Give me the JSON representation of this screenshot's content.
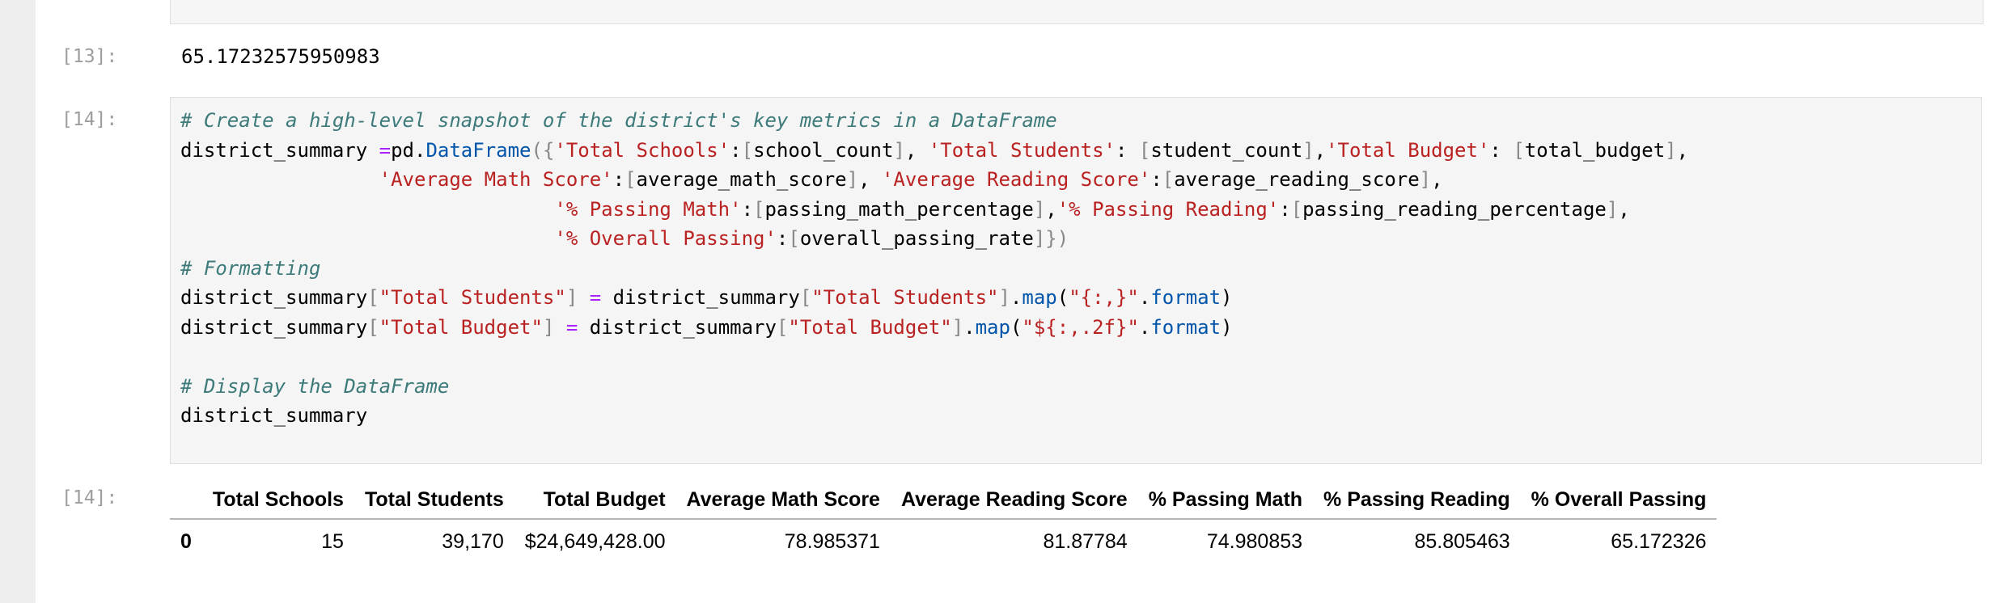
{
  "cells": {
    "prompt_13": "[13]:",
    "output_13": "65.17232575950983",
    "prompt_14": "[14]:",
    "prompt_14_out": "[14]:"
  },
  "code_lines": [
    [
      {
        "t": "com",
        "v": "# Create a high-level snapshot of the district's key metrics in a DataFrame"
      }
    ],
    [
      {
        "t": "txt",
        "v": "district_summary "
      },
      {
        "t": "op",
        "v": "="
      },
      {
        "t": "txt",
        "v": "pd."
      },
      {
        "t": "attr",
        "v": "DataFrame"
      },
      {
        "t": "pun",
        "v": "({"
      },
      {
        "t": "str",
        "v": "'Total Schools'"
      },
      {
        "t": "txt",
        "v": ":"
      },
      {
        "t": "pun",
        "v": "["
      },
      {
        "t": "txt",
        "v": "school_count"
      },
      {
        "t": "pun",
        "v": "]"
      },
      {
        "t": "txt",
        "v": ", "
      },
      {
        "t": "str",
        "v": "'Total Students'"
      },
      {
        "t": "txt",
        "v": ": "
      },
      {
        "t": "pun",
        "v": "["
      },
      {
        "t": "txt",
        "v": "student_count"
      },
      {
        "t": "pun",
        "v": "]"
      },
      {
        "t": "txt",
        "v": ","
      },
      {
        "t": "str",
        "v": "'Total Budget'"
      },
      {
        "t": "txt",
        "v": ": "
      },
      {
        "t": "pun",
        "v": "["
      },
      {
        "t": "txt",
        "v": "total_budget"
      },
      {
        "t": "pun",
        "v": "]"
      },
      {
        "t": "txt",
        "v": ","
      }
    ],
    [
      {
        "t": "txt",
        "v": "                 "
      },
      {
        "t": "str",
        "v": "'Average Math Score'"
      },
      {
        "t": "txt",
        "v": ":"
      },
      {
        "t": "pun",
        "v": "["
      },
      {
        "t": "txt",
        "v": "average_math_score"
      },
      {
        "t": "pun",
        "v": "]"
      },
      {
        "t": "txt",
        "v": ", "
      },
      {
        "t": "str",
        "v": "'Average Reading Score'"
      },
      {
        "t": "txt",
        "v": ":"
      },
      {
        "t": "pun",
        "v": "["
      },
      {
        "t": "txt",
        "v": "average_reading_score"
      },
      {
        "t": "pun",
        "v": "]"
      },
      {
        "t": "txt",
        "v": ","
      }
    ],
    [
      {
        "t": "txt",
        "v": "                                "
      },
      {
        "t": "str",
        "v": "'% Passing Math'"
      },
      {
        "t": "txt",
        "v": ":"
      },
      {
        "t": "pun",
        "v": "["
      },
      {
        "t": "txt",
        "v": "passing_math_percentage"
      },
      {
        "t": "pun",
        "v": "]"
      },
      {
        "t": "txt",
        "v": ","
      },
      {
        "t": "str",
        "v": "'% Passing Reading'"
      },
      {
        "t": "txt",
        "v": ":"
      },
      {
        "t": "pun",
        "v": "["
      },
      {
        "t": "txt",
        "v": "passing_reading_percentage"
      },
      {
        "t": "pun",
        "v": "]"
      },
      {
        "t": "txt",
        "v": ","
      }
    ],
    [
      {
        "t": "txt",
        "v": "                                "
      },
      {
        "t": "str",
        "v": "'% Overall Passing'"
      },
      {
        "t": "txt",
        "v": ":"
      },
      {
        "t": "pun",
        "v": "["
      },
      {
        "t": "txt",
        "v": "overall_passing_rate"
      },
      {
        "t": "pun",
        "v": "]})"
      }
    ],
    [
      {
        "t": "com",
        "v": "# Formatting"
      }
    ],
    [
      {
        "t": "txt",
        "v": "district_summary"
      },
      {
        "t": "pun",
        "v": "["
      },
      {
        "t": "str",
        "v": "\"Total Students\""
      },
      {
        "t": "pun",
        "v": "]"
      },
      {
        "t": "txt",
        "v": " "
      },
      {
        "t": "op",
        "v": "="
      },
      {
        "t": "txt",
        "v": " district_summary"
      },
      {
        "t": "pun",
        "v": "["
      },
      {
        "t": "str",
        "v": "\"Total Students\""
      },
      {
        "t": "pun",
        "v": "]"
      },
      {
        "t": "txt",
        "v": "."
      },
      {
        "t": "attr",
        "v": "map"
      },
      {
        "t": "txt",
        "v": "("
      },
      {
        "t": "str",
        "v": "\"{:,}\""
      },
      {
        "t": "txt",
        "v": "."
      },
      {
        "t": "attr",
        "v": "format"
      },
      {
        "t": "txt",
        "v": ")"
      }
    ],
    [
      {
        "t": "txt",
        "v": "district_summary"
      },
      {
        "t": "pun",
        "v": "["
      },
      {
        "t": "str",
        "v": "\"Total Budget\""
      },
      {
        "t": "pun",
        "v": "]"
      },
      {
        "t": "txt",
        "v": " "
      },
      {
        "t": "op",
        "v": "="
      },
      {
        "t": "txt",
        "v": " district_summary"
      },
      {
        "t": "pun",
        "v": "["
      },
      {
        "t": "str",
        "v": "\"Total Budget\""
      },
      {
        "t": "pun",
        "v": "]"
      },
      {
        "t": "txt",
        "v": "."
      },
      {
        "t": "attr",
        "v": "map"
      },
      {
        "t": "txt",
        "v": "("
      },
      {
        "t": "str",
        "v": "\"${:,.2f}\""
      },
      {
        "t": "txt",
        "v": "."
      },
      {
        "t": "attr",
        "v": "format"
      },
      {
        "t": "txt",
        "v": ")"
      }
    ],
    [
      {
        "t": "txt",
        "v": ""
      }
    ],
    [
      {
        "t": "com",
        "v": "# Display the DataFrame"
      }
    ],
    [
      {
        "t": "txt",
        "v": "district_summary"
      }
    ]
  ],
  "dataframe": {
    "columns": [
      "",
      "Total Schools",
      "Total Students",
      "Total Budget",
      "Average Math Score",
      "Average Reading Score",
      "% Passing Math",
      "% Passing Reading",
      "% Overall Passing"
    ],
    "rows": [
      [
        "0",
        "15",
        "39,170",
        "$24,649,428.00",
        "78.985371",
        "81.87784",
        "74.980853",
        "85.805463",
        "65.172326"
      ]
    ]
  }
}
